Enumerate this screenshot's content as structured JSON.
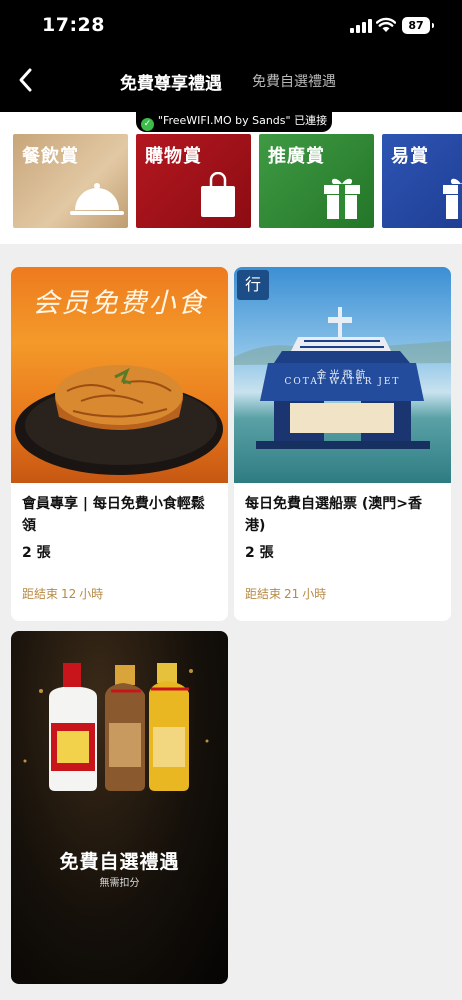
{
  "status_bar": {
    "time": "17:28",
    "battery": "87"
  },
  "header": {
    "title": "免費尊享禮遇",
    "tab_secondary": "免費自選禮遇"
  },
  "wifi_banner": {
    "text": "\"FreeWIFI.MO by Sands\" 已連接"
  },
  "categories": [
    {
      "label": "餐飲賞",
      "icon": "cloche-icon"
    },
    {
      "label": "購物賞",
      "icon": "shopping-bag-icon"
    },
    {
      "label": "推廣賞",
      "icon": "gift-icon"
    },
    {
      "label": "易賞",
      "icon": "gift-icon"
    }
  ],
  "offers": [
    {
      "image_text": "会员免费小食",
      "title": "會員專享 | 每日免費小食輕鬆領",
      "quantity": "2 張",
      "expiry_prefix": "距結束",
      "expiry_hours": "12",
      "expiry_unit": "小時"
    },
    {
      "image_tag": "行",
      "image_text_cn": "金光飛航",
      "image_text_en": "COTAI WATER JET",
      "title": "每日免費自選船票 (澳門>香港)",
      "quantity": "2 張",
      "expiry_prefix": "距結束",
      "expiry_hours": "21",
      "expiry_unit": "小時"
    }
  ],
  "promo": {
    "title": "免費自選禮遇",
    "subtitle": "無需扣分"
  },
  "colors": {
    "accent_gold": "#b88a45",
    "header_bg": "#000000"
  }
}
